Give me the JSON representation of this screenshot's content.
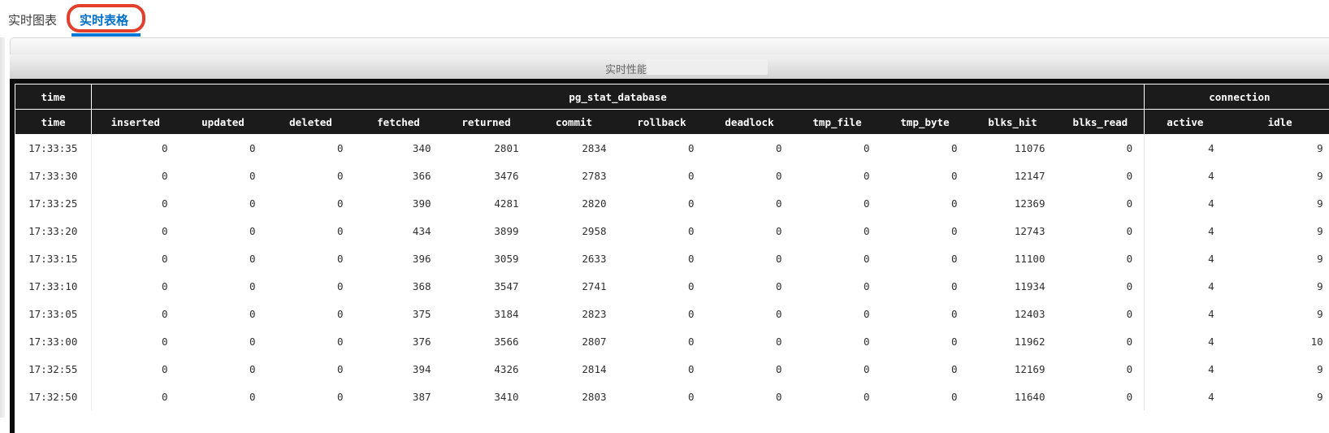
{
  "tabs": [
    {
      "label": "实时图表",
      "active": false
    },
    {
      "label": "实时表格",
      "active": true
    }
  ],
  "panel": {
    "title": "实时性能"
  },
  "table": {
    "groups": [
      {
        "label": "time",
        "colspan": 1
      },
      {
        "label": "pg_stat_database",
        "colspan": 12
      },
      {
        "label": "connection",
        "colspan": 2
      }
    ],
    "columns": [
      "time",
      "inserted",
      "updated",
      "deleted",
      "fetched",
      "returned",
      "commit",
      "rollback",
      "deadlock",
      "tmp_file",
      "tmp_byte",
      "blks_hit",
      "blks_read",
      "active",
      "idle"
    ],
    "rows": [
      [
        "17:33:35",
        "0",
        "0",
        "0",
        "340",
        "2801",
        "2834",
        "0",
        "0",
        "0",
        "0",
        "11076",
        "0",
        "4",
        "9"
      ],
      [
        "17:33:30",
        "0",
        "0",
        "0",
        "366",
        "3476",
        "2783",
        "0",
        "0",
        "0",
        "0",
        "12147",
        "0",
        "4",
        "9"
      ],
      [
        "17:33:25",
        "0",
        "0",
        "0",
        "390",
        "4281",
        "2820",
        "0",
        "0",
        "0",
        "0",
        "12369",
        "0",
        "4",
        "9"
      ],
      [
        "17:33:20",
        "0",
        "0",
        "0",
        "434",
        "3899",
        "2958",
        "0",
        "0",
        "0",
        "0",
        "12743",
        "0",
        "4",
        "9"
      ],
      [
        "17:33:15",
        "0",
        "0",
        "0",
        "396",
        "3059",
        "2633",
        "0",
        "0",
        "0",
        "0",
        "11100",
        "0",
        "4",
        "9"
      ],
      [
        "17:33:10",
        "0",
        "0",
        "0",
        "368",
        "3547",
        "2741",
        "0",
        "0",
        "0",
        "0",
        "11934",
        "0",
        "4",
        "9"
      ],
      [
        "17:33:05",
        "0",
        "0",
        "0",
        "375",
        "3184",
        "2823",
        "0",
        "0",
        "0",
        "0",
        "12403",
        "0",
        "4",
        "9"
      ],
      [
        "17:33:00",
        "0",
        "0",
        "0",
        "376",
        "3566",
        "2807",
        "0",
        "0",
        "0",
        "0",
        "11962",
        "0",
        "4",
        "10"
      ],
      [
        "17:32:55",
        "0",
        "0",
        "0",
        "394",
        "4326",
        "2814",
        "0",
        "0",
        "0",
        "0",
        "12169",
        "0",
        "4",
        "9"
      ],
      [
        "17:32:50",
        "0",
        "0",
        "0",
        "387",
        "3410",
        "2803",
        "0",
        "0",
        "0",
        "0",
        "11640",
        "0",
        "4",
        "9"
      ]
    ]
  },
  "colors": {
    "accent_blue": "#0078d7",
    "active_tab_text": "#0070c9",
    "annotation_red": "#e2402c",
    "header_bg": "#1b1b1b",
    "header_text": "#ffffff"
  }
}
